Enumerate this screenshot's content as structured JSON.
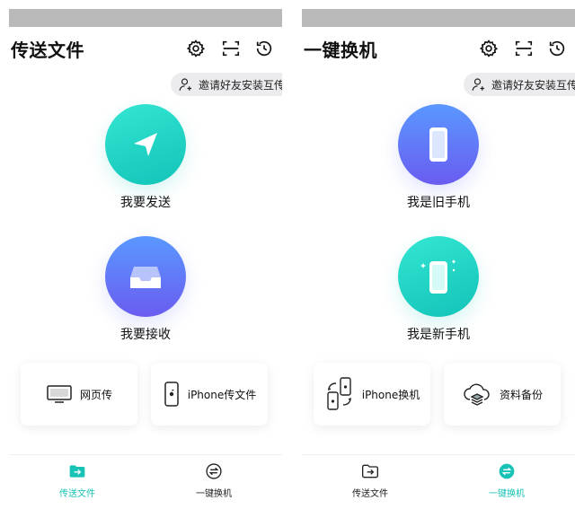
{
  "colors": {
    "accent_teal": "#18c2b5",
    "gradient_teal_start": "#34e6d2",
    "gradient_blue_start": "#5a98ff",
    "gradient_blue_end": "#6a5cf0",
    "status_bar": "#b9b9b9"
  },
  "left": {
    "title": "传送文件",
    "icons": [
      "gear-icon",
      "scan-icon",
      "history-icon"
    ],
    "invite_label": "邀请好友安装互传",
    "action1_label": "我要发送",
    "action2_label": "我要接收",
    "card1_label": "网页传",
    "card2_label": "iPhone传文件",
    "nav": [
      {
        "label": "传送文件",
        "active": true
      },
      {
        "label": "一键换机",
        "active": false
      }
    ]
  },
  "right": {
    "title": "一键换机",
    "icons": [
      "gear-icon",
      "scan-icon",
      "history-icon"
    ],
    "invite_label": "邀请好友安装互传",
    "action1_label": "我是旧手机",
    "action2_label": "我是新手机",
    "card1_label": "iPhone换机",
    "card2_label": "资料备份",
    "nav": [
      {
        "label": "传送文件",
        "active": false
      },
      {
        "label": "一键换机",
        "active": true
      }
    ]
  }
}
